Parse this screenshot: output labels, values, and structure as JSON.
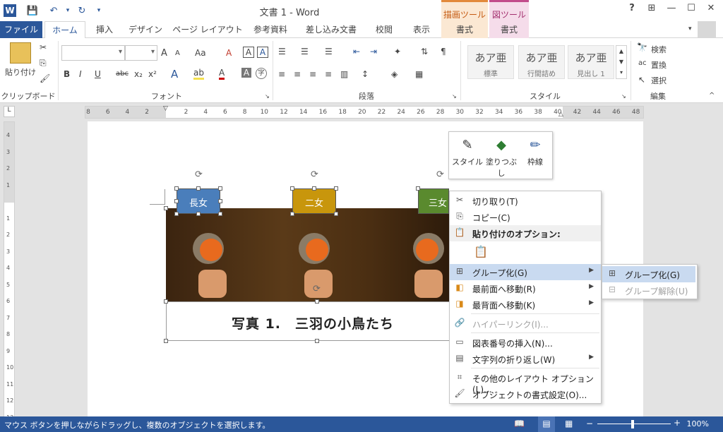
{
  "window": {
    "title": "文書 1 - Word",
    "help": "?",
    "restore_ribbon": "⊞",
    "minimize": "—",
    "maximize": "☐",
    "close": "✕"
  },
  "context_tabs": {
    "drawing_tools": "描画ツール",
    "picture_tools": "図ツール"
  },
  "tabs": [
    "ファイル",
    "ホーム",
    "挿入",
    "デザイン",
    "ページ レイアウト",
    "参考資料",
    "差し込み文書",
    "校閲",
    "表示",
    "書式",
    "書式"
  ],
  "ribbon": {
    "clipboard": {
      "label": "クリップボード",
      "paste": "貼り付け"
    },
    "font": {
      "label": "フォント",
      "name": "",
      "size": "",
      "bold": "B",
      "italic": "I",
      "underline": "U",
      "strike": "abc",
      "sub": "x₂",
      "sup": "x²",
      "grow": "A",
      "shrink": "A",
      "case": "Aa",
      "clear": "A",
      "char_border": "A"
    },
    "paragraph": {
      "label": "段落"
    },
    "styles": {
      "label": "スタイル",
      "items": [
        {
          "sample": "あア亜",
          "name": "標準"
        },
        {
          "sample": "あア亜",
          "name": "行間詰め"
        },
        {
          "sample": "あア亜",
          "name": "見出し 1"
        }
      ]
    },
    "editing": {
      "label": "編集",
      "find": "検索",
      "replace": "置換",
      "select": "選択"
    }
  },
  "ruler": {
    "ticks": [
      "8",
      "6",
      "4",
      "2",
      "",
      "2",
      "4",
      "6",
      "8",
      "10",
      "12",
      "14",
      "16",
      "18",
      "20",
      "22",
      "24",
      "26",
      "28",
      "30",
      "32",
      "34",
      "36",
      "38",
      "40",
      "42",
      "44",
      "46",
      "48"
    ]
  },
  "vruler": {
    "ticks": [
      "4",
      "3",
      "2",
      "1",
      "",
      "1",
      "2",
      "3",
      "4",
      "5",
      "6",
      "7",
      "8",
      "9",
      "10",
      "11",
      "12",
      "13"
    ]
  },
  "document": {
    "labels": [
      {
        "text": "長女",
        "color": "#4a7ebb"
      },
      {
        "text": "二女",
        "color": "#c8960c"
      },
      {
        "text": "三女",
        "color": "#5a8a2e"
      }
    ],
    "caption": "写真 1.　三羽の小鳥たち"
  },
  "mini_toolbar": {
    "style": "スタイル",
    "fill": "塗りつぶし",
    "outline": "枠線"
  },
  "context_menu": {
    "cut": "切り取り(T)",
    "copy": "コピー(C)",
    "paste_options": "貼り付けのオプション:",
    "group": "グループ化(G)",
    "bring_front": "最前面へ移動(R)",
    "send_back": "最背面へ移動(K)",
    "hyperlink": "ハイパーリンク(I)...",
    "insert_caption": "図表番号の挿入(N)...",
    "wrap_text": "文字列の折り返し(W)",
    "layout_options": "その他のレイアウト オプション(L)...",
    "format_object": "オブジェクトの書式設定(O)..."
  },
  "submenu": {
    "group": "グループ化(G)",
    "ungroup": "グループ解除(U)"
  },
  "status": {
    "text": "マウス ボタンを押しながらドラッグし、複数のオブジェクトを選択します。",
    "zoom": "100%"
  }
}
